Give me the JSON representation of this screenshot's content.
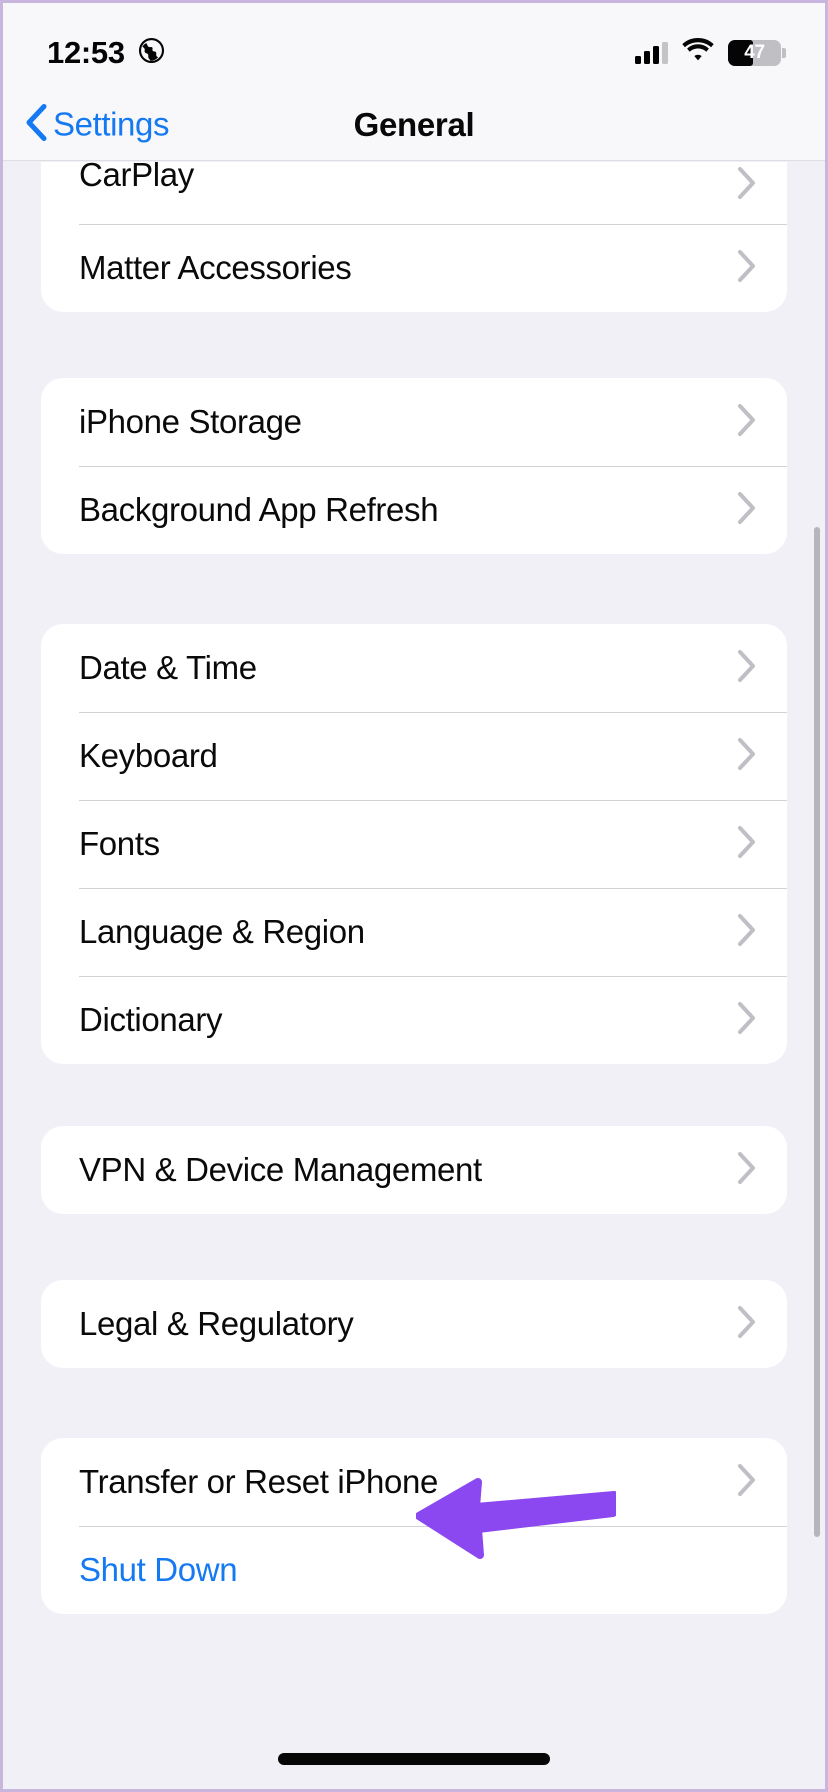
{
  "status_bar": {
    "time": "12:53",
    "location_icon": "globe-icon",
    "cellular_icon": "cellular-bars-icon",
    "wifi_icon": "wifi-icon",
    "battery_percent": "47",
    "battery_level": 47
  },
  "nav_bar": {
    "back_label": "Settings",
    "back_icon": "chevron-left-icon",
    "title": "General"
  },
  "groups": [
    {
      "id": "accessories-group",
      "clipped_top": true,
      "rows": [
        {
          "label": "CarPlay",
          "accessory": "chevron-right-icon",
          "clipped": true,
          "style": "default"
        },
        {
          "label": "Matter Accessories",
          "accessory": "chevron-right-icon",
          "clipped": false,
          "style": "default"
        }
      ]
    },
    {
      "id": "storage-group",
      "clipped_top": false,
      "rows": [
        {
          "label": "iPhone Storage",
          "accessory": "chevron-right-icon",
          "clipped": false,
          "style": "default"
        },
        {
          "label": "Background App Refresh",
          "accessory": "chevron-right-icon",
          "clipped": false,
          "style": "default"
        }
      ]
    },
    {
      "id": "localization-group",
      "clipped_top": false,
      "rows": [
        {
          "label": "Date & Time",
          "accessory": "chevron-right-icon",
          "clipped": false,
          "style": "default"
        },
        {
          "label": "Keyboard",
          "accessory": "chevron-right-icon",
          "clipped": false,
          "style": "default"
        },
        {
          "label": "Fonts",
          "accessory": "chevron-right-icon",
          "clipped": false,
          "style": "default"
        },
        {
          "label": "Language & Region",
          "accessory": "chevron-right-icon",
          "clipped": false,
          "style": "default"
        },
        {
          "label": "Dictionary",
          "accessory": "chevron-right-icon",
          "clipped": false,
          "style": "default"
        }
      ]
    },
    {
      "id": "vpn-group",
      "clipped_top": false,
      "rows": [
        {
          "label": "VPN & Device Management",
          "accessory": "chevron-right-icon",
          "clipped": false,
          "style": "default"
        }
      ]
    },
    {
      "id": "legal-group",
      "clipped_top": false,
      "rows": [
        {
          "label": "Legal & Regulatory",
          "accessory": "chevron-right-icon",
          "clipped": false,
          "style": "default"
        }
      ]
    },
    {
      "id": "reset-group",
      "clipped_top": false,
      "rows": [
        {
          "label": "Transfer or Reset iPhone",
          "accessory": "chevron-right-icon",
          "clipped": false,
          "style": "default"
        },
        {
          "label": "Shut Down",
          "accessory": "none",
          "clipped": false,
          "style": "link"
        }
      ]
    }
  ],
  "annotation": {
    "type": "arrow",
    "direction": "left",
    "color": "#8B47F0",
    "points_at": "Transfer or Reset iPhone"
  },
  "colors": {
    "page_background": "#F1F0F6",
    "card_background": "#FFFFFF",
    "bar_background": "#F8F8FA",
    "accent_blue": "#1579F2",
    "primary_text": "#0A0A0A",
    "separator": "#D2D1D6",
    "chevron_gray": "#BFBFC6",
    "annotation_purple": "#8B47F0",
    "frame_border": "#C9B6DE"
  },
  "home_indicator": "home-indicator-bar",
  "scrollbar": "vertical-scroll-indicator"
}
